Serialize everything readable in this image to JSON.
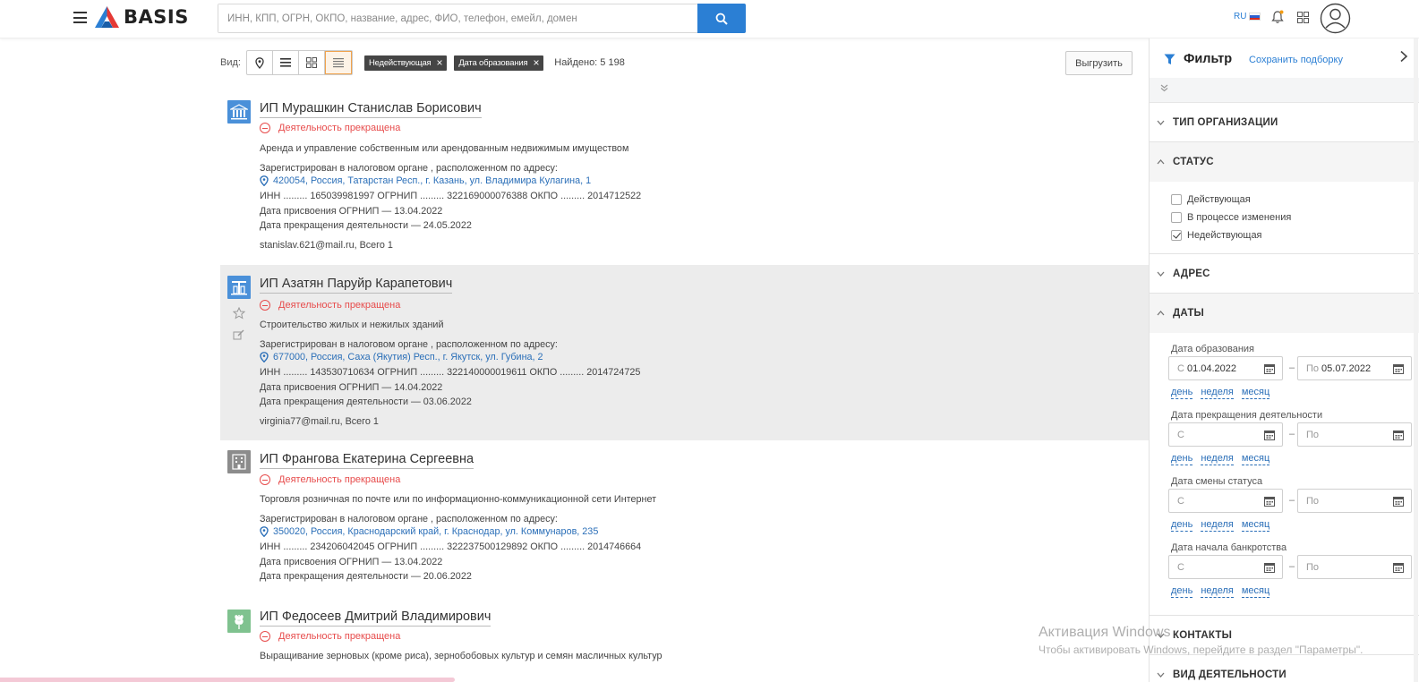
{
  "header": {
    "logo_text": "BASIS",
    "search_placeholder": "ИНН, КПП, ОГРН, ОКПО, название, адрес, ФИО, телефон, емейл, домен",
    "lang": "RU"
  },
  "toolbar": {
    "view_label": "Вид:",
    "chips": [
      "Недействующая",
      "Дата образования"
    ],
    "found": "Найдено: 5 198",
    "export": "Выгрузить"
  },
  "results": [
    {
      "title": "ИП Мурашкин Станислав Борисович",
      "status": "Деятельность прекращена",
      "activity": "Аренда и управление собственным или арендованным недвижимым имуществом",
      "reg": "Зарегистрирован в налоговом органе , расположенном по адресу:",
      "address": "420054, Россия, Татарстан Респ., г. Казань, ул. Владимира Кулагина, 1",
      "codes": "ИНН ......... 165039981997 ОГРНИП ......... 322169000076388 ОКПО ......... 2014712522",
      "ogrnip_date": "Дата присвоения ОГРНИП — 13.04.2022",
      "end_date": "Дата прекращения деятельности — 24.05.2022",
      "contact": "stanislav.621@mail.ru, Всего 1",
      "icon_color": "#4a90d9"
    },
    {
      "title": "ИП Азатян Паруйр Карапетович",
      "status": "Деятельность прекращена",
      "activity": "Строительство жилых и нежилых зданий",
      "reg": "Зарегистрирован в налоговом органе , расположенном по адресу:",
      "address": "677000, Россия, Саха (Якутия) Респ., г. Якутск, ул. Губина, 2",
      "codes": "ИНН ......... 143530710634 ОГРНИП ......... 322140000019611 ОКПО ......... 2014724725",
      "ogrnip_date": "Дата присвоения ОГРНИП — 14.04.2022",
      "end_date": "Дата прекращения деятельности — 03.06.2022",
      "contact": "virginia77@mail.ru, Всего 1",
      "icon_color": "#4a90d9"
    },
    {
      "title": "ИП Франгова Екатерина Сергеевна",
      "status": "Деятельность прекращена",
      "activity": "Торговля розничная по почте или по информационно-коммуникационной сети Интернет",
      "reg": "Зарегистрирован в налоговом органе , расположенном по адресу:",
      "address": "350020, Россия, Краснодарский край, г. Краснодар, ул. Коммунаров, 235",
      "codes": "ИНН ......... 234206042045 ОГРНИП ......... 322237500129892 ОКПО ......... 2014746664",
      "ogrnip_date": "Дата присвоения ОГРНИП — 13.04.2022",
      "end_date": "Дата прекращения деятельности — 20.06.2022",
      "icon_color": "#8c8c8c"
    },
    {
      "title": "ИП Федосеев Дмитрий Владимирович",
      "status": "Деятельность прекращена",
      "activity": "Выращивание зерновых (кроме риса), зернобобовых культур и семян масличных культур",
      "icon_color": "#7fc28f"
    }
  ],
  "filter": {
    "title": "Фильтр",
    "save": "Сохранить подборку",
    "sections": {
      "org_type": "ТИП ОРГАНИЗАЦИИ",
      "status": "СТАТУС",
      "address": "АДРЕС",
      "dates": "ДАТЫ",
      "contacts": "КОНТАКТЫ",
      "activity": "ВИД ДЕЯТЕЛЬНОСТИ"
    },
    "status_options": [
      {
        "label": "Действующая",
        "checked": false
      },
      {
        "label": "В процессе изменения",
        "checked": false
      },
      {
        "label": "Недействующая",
        "checked": true
      }
    ],
    "date_groups": [
      {
        "label": "Дата образования",
        "from": "01.04.2022",
        "to": "05.07.2022"
      },
      {
        "label": "Дата прекращения деятельности",
        "from": "",
        "to": ""
      },
      {
        "label": "Дата смены статуса",
        "from": "",
        "to": ""
      },
      {
        "label": "Дата начала банкротства",
        "from": "",
        "to": ""
      }
    ],
    "from_prefix": "С",
    "to_prefix": "По",
    "dash": "–",
    "quick_links": [
      "день",
      "неделя",
      "месяц"
    ]
  },
  "watermark": {
    "title": "Активация Windows",
    "subtitle": "Чтобы активировать Windows, перейдите в раздел \"Параметры\"."
  }
}
